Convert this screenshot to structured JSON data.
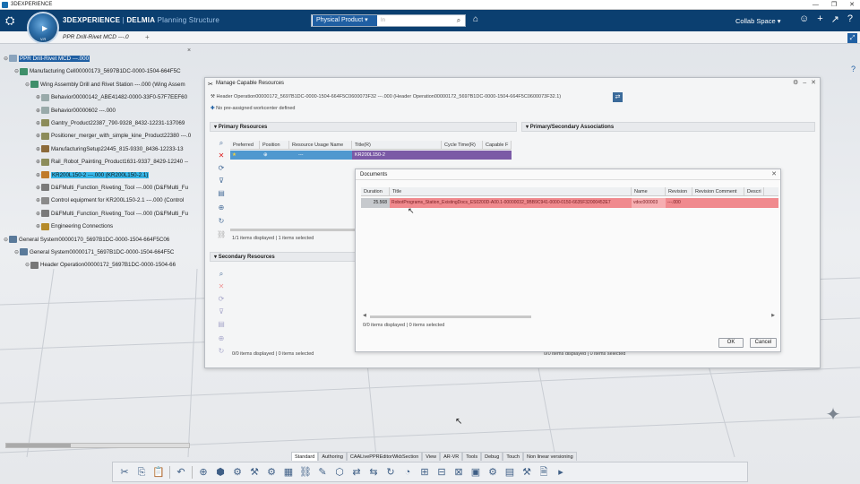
{
  "app": {
    "title": "3DEXPERIENCE",
    "brand_bold": "3DEXPERIENCE",
    "brand_sep": " | ",
    "brand_product": "DELMIA",
    "brand_app": " Planning Structure",
    "compass_ver": "V.R"
  },
  "search": {
    "scope": "Physical Product ▾",
    "placeholder": "In"
  },
  "header": {
    "collab_space": "Collab Space ▾"
  },
  "tab": {
    "label": "PPR Drill-Rivet MCD ---.0",
    "add": "+"
  },
  "tree": [
    {
      "label": "PPR Drill-Rivet MCD ---.000",
      "icon": "ppr-icon",
      "sel": "1"
    },
    {
      "label": "Manufacturing Cell00000173_5697B1DC-0000-1504-664F5C",
      "icon": "manufacturing-cell-icon"
    },
    {
      "label": "Wing Assembly Drill and Rivet Station ---.000 (Wing Assem",
      "icon": "station-icon"
    },
    {
      "label": "Behavior00000142_ABE41482-0000-33F0-57F7EEF60",
      "icon": "behavior-icon"
    },
    {
      "label": "Behavior00000602 ---.000",
      "icon": "behavior-icon"
    },
    {
      "label": "Gantry_Product22387_790-9328_8432-12231-137069",
      "icon": "product-icon"
    },
    {
      "label": "Positioner_merger_with_simple_kine_Product22380 ---.0",
      "icon": "product-icon"
    },
    {
      "label": "ManufacturingSetup22445_815-9330_8436-12233-13",
      "icon": "setup-icon"
    },
    {
      "label": "Rail_Robot_Painting_Product1631-9337_8429-12240 --",
      "icon": "product-icon"
    },
    {
      "label": "KR200L150-2 ---.000 (KR200L150-2.1)",
      "icon": "robot-icon",
      "sel": "2"
    },
    {
      "label": "D&FMulti_Function_Riveting_Tool ---.000 (D&FMulti_Fu",
      "icon": "tool-icon"
    },
    {
      "label": "Control equipment for KR200L150-2.1 ---.000 (Control",
      "icon": "controller-icon"
    },
    {
      "label": "D&FMulti_Function_Riveting_Tool ---.000 (D&FMulti_Fu",
      "icon": "tool-icon"
    },
    {
      "label": "Engineering Connections",
      "icon": "connections-icon"
    },
    {
      "label": "General System00000170_5697B1DC-0000-1504-664F5C06",
      "icon": "system-icon"
    },
    {
      "label": "General System00000171_5697B1DC-0000-1504-664F5C",
      "icon": "system-icon"
    },
    {
      "label": "Header Operation00000172_5697B1DC-0000-1504-66",
      "icon": "operation-icon"
    }
  ],
  "capable": {
    "title": "Manage Capable Resources",
    "header_op": "Header Operation00000172_5697B1DC-0000-1504-664F5C0600073F32 ---.000 (Header Operation00000172_5697B1DC-0000-1504-664F5C0600073F32.1)",
    "no_workcenter": "No pre-assigned workcenter defined",
    "primary": "Primary Resources",
    "secondary": "Secondary Resources",
    "assoc": "Primary/Secondary Associations",
    "cols": [
      "Preferred",
      "Position",
      "Resource Usage Name",
      "Title(R)",
      "Cycle Time(R)",
      "Capable F"
    ],
    "row_title": "KR200L150-2",
    "row_usage": "---",
    "primary_status": "1/1 items displayed | 1 items selected",
    "secondary_status": "0/0 items displayed | 0 items selected",
    "assoc_status": "0/0 items displayed | 0 items selected"
  },
  "documents": {
    "title": "Documents",
    "cols": [
      "Duration",
      "Title",
      "Name",
      "Revision",
      "Revision Comment",
      "Descri"
    ],
    "row": {
      "duration": "25.568",
      "title": "RobotPrograms_Station_ExistingDocs_ES0200D-A00.1-00000032_9BB9C941-0000-0150-6635F32000452E7",
      "name": "vdoc000003",
      "revision": "---.000"
    },
    "status": "0/0 items displayed | 0 items selected",
    "ok": "OK",
    "cancel": "Cancel"
  },
  "workshop_tabs": [
    "Standard",
    "Authoring",
    "CAALivePPREditorWkbSection",
    "View",
    "AR-VR",
    "Tools",
    "Debug",
    "Touch",
    "Non linear versioning"
  ],
  "colors": {
    "topbar": "#0b3f70",
    "selection": "#1f5fa3",
    "highlight": "#36b6e8",
    "row_selected": "#4f98cf",
    "doc_row": "#f08a8e"
  }
}
